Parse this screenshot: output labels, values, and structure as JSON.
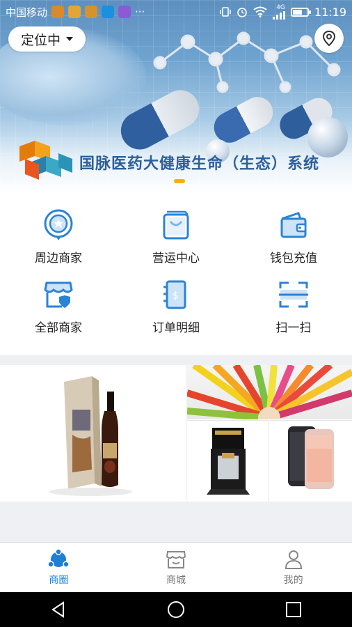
{
  "status_bar": {
    "carrier": "中国移动",
    "more": "···",
    "network": "4G",
    "time": "11:19"
  },
  "header": {
    "location_label": "定位中",
    "map_icon": "location-pin-icon"
  },
  "banner": {
    "title": "国脉医药大健康生命（生态）系统",
    "indicator_color": "#f0b400"
  },
  "quick_menu": [
    {
      "label": "周边商家",
      "icon": "nearby-merchant-icon"
    },
    {
      "label": "营运中心",
      "icon": "shopping-bag-icon"
    },
    {
      "label": "钱包充值",
      "icon": "wallet-icon"
    },
    {
      "label": "全部商家",
      "icon": "store-icon"
    },
    {
      "label": "订单明细",
      "icon": "order-detail-icon"
    },
    {
      "label": "扫一扫",
      "icon": "scan-icon"
    }
  ],
  "tabbar": {
    "items": [
      {
        "label": "商圈",
        "icon": "business-circle-icon",
        "active": true
      },
      {
        "label": "商城",
        "icon": "mall-icon",
        "active": false
      },
      {
        "label": "我的",
        "icon": "profile-icon",
        "active": false
      }
    ]
  },
  "colors": {
    "accent": "#1f7fd6",
    "icon_blue": "#2b83d4"
  }
}
